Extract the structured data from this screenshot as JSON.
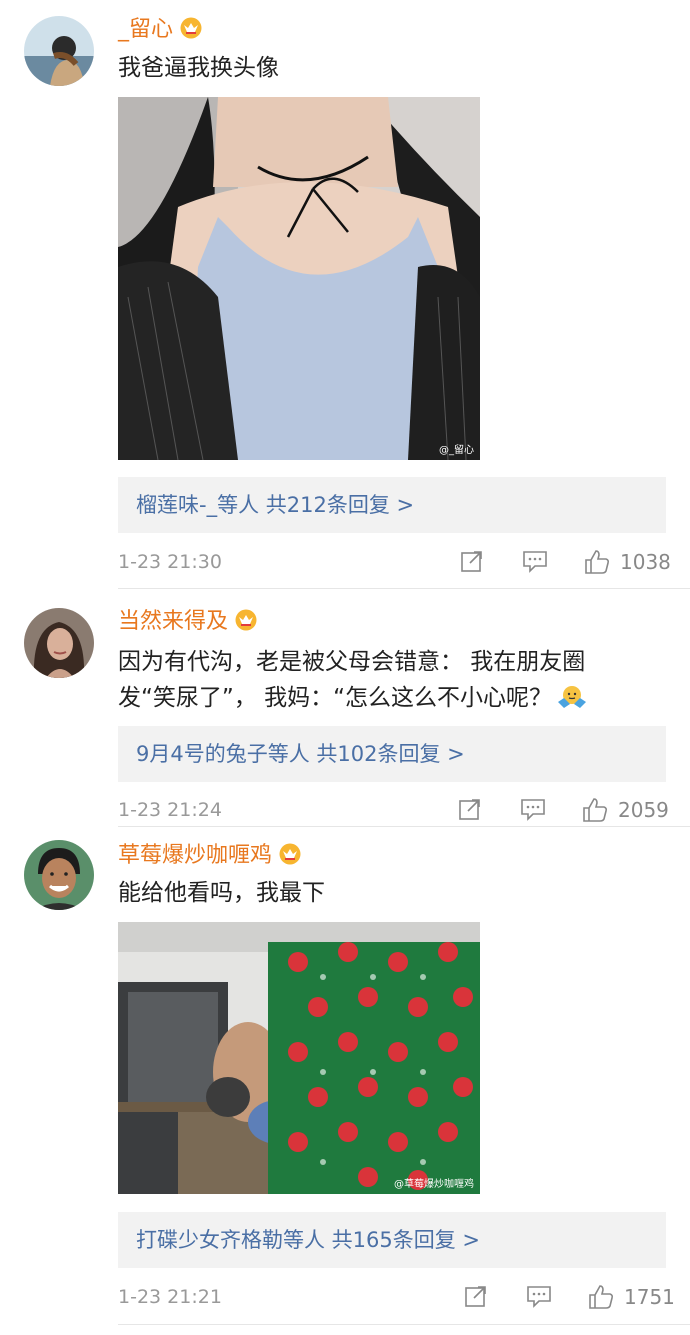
{
  "comments": [
    {
      "username": "_留心",
      "text": "我爸逼我换头像",
      "image_watermark": "@_留心",
      "replies": "榴莲味-_等人  共212条回复 >",
      "time": "1-23 21:30",
      "likes": "1038"
    },
    {
      "username": "当然来得及",
      "text_line1": "因为有代沟，老是被父母会错意： 我在朋友圈",
      "text_line2": "发“笑尿了”， 我妈：“怎么这么不小心呢？",
      "replies": "9月4号的兔子等人  共102条回复 >",
      "time": "1-23 21:24",
      "likes": "2059"
    },
    {
      "username": "草莓爆炒咖喱鸡",
      "text": "能给他看吗，我最下",
      "image_watermark": "@草莓爆炒咖喱鸡",
      "replies": "打碟少女齐格勒等人  共165条回复 >",
      "time": "1-23 21:21",
      "likes": "1751"
    }
  ],
  "icons": {
    "crown": "crown-badge-icon",
    "share": "share-icon",
    "comment": "comment-icon",
    "like": "thumbs-up-icon",
    "emoji": "shrug-emoji-icon"
  },
  "colors": {
    "username": "#e8781f",
    "replies_link": "#4a6fa5",
    "meta": "#999999",
    "reply_bg": "#f2f2f2"
  }
}
